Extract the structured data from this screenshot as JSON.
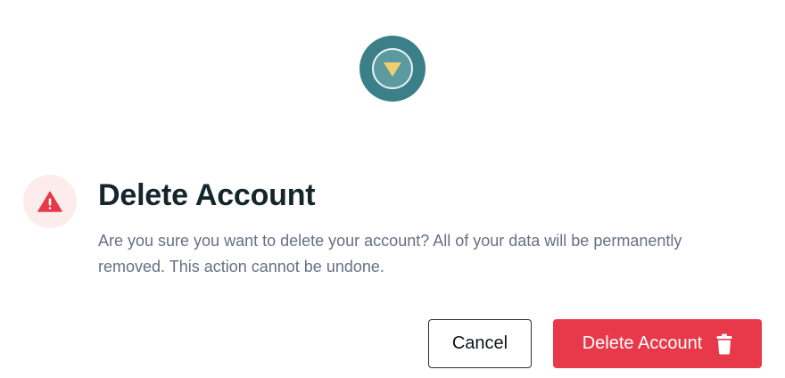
{
  "dialog": {
    "title": "Delete Account",
    "message": "Are you sure you want to delete your account? All of your data will be permanently removed. This action cannot be undone.",
    "icons": {
      "logo": "app-logo-icon",
      "warning": "warning-triangle-icon",
      "trash": "trash-icon"
    },
    "buttons": {
      "cancel_label": "Cancel",
      "delete_label": "Delete Account"
    }
  },
  "colors": {
    "danger": "#e8394a",
    "danger_tint": "#fdecec",
    "logo_teal": "#3b8088",
    "logo_accent": "#f2cd6b",
    "title_text": "#14262b",
    "body_text": "#667085"
  }
}
